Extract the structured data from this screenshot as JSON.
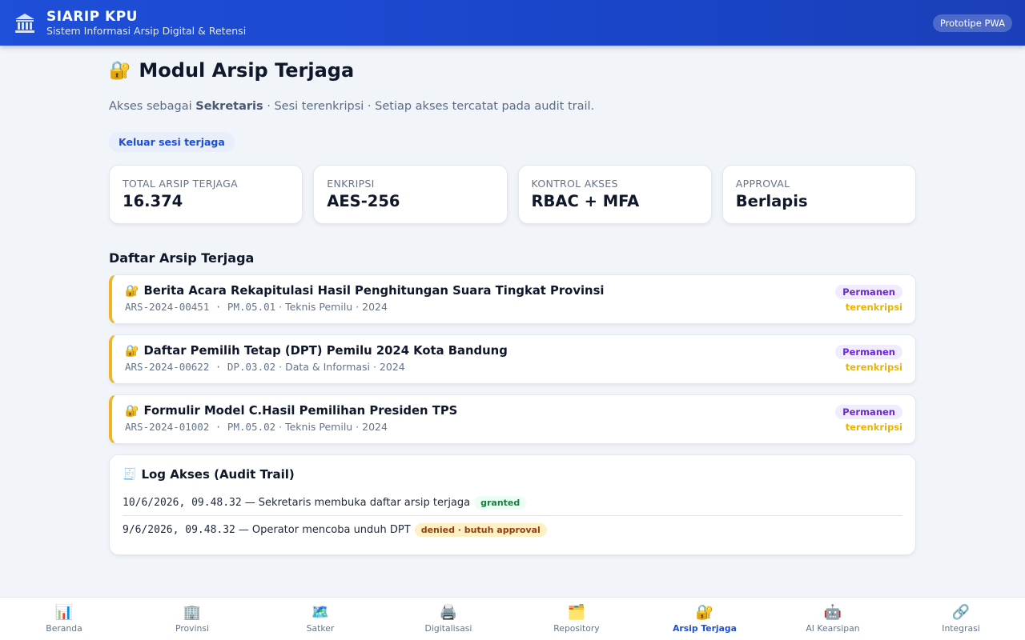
{
  "header": {
    "title": "SIARIP KPU",
    "subtitle": "Sistem Informasi Arsip Digital & Retensi",
    "badge": "Prototipe PWA"
  },
  "page": {
    "title": "Modul Arsip Terjaga",
    "subtitle_prefix": "Akses sebagai ",
    "role": "Sekretaris",
    "subtitle_suffix": " · Sesi terenkripsi · Setiap akses tercatat pada audit trail.",
    "logout_label": "Keluar sesi terjaga"
  },
  "stats": [
    {
      "label": "TOTAL ARSIP TERJAGA",
      "value": "16.374"
    },
    {
      "label": "ENKRIPSI",
      "value": "AES-256"
    },
    {
      "label": "KONTROL AKSES",
      "value": "RBAC + MFA"
    },
    {
      "label": "APPROVAL",
      "value": "Berlapis"
    }
  ],
  "list_title": "Daftar Arsip Terjaga",
  "archives": [
    {
      "title": "Berita Acara Rekapitulasi Hasil Penghitungan Suara Tingkat Provinsi",
      "code": "ARS-2024-00451 · PM.05.01",
      "meta": " · Teknis Pemilu · 2024",
      "retention": "Permanen",
      "status": "terenkripsi"
    },
    {
      "title": "Daftar Pemilih Tetap (DPT) Pemilu 2024 Kota Bandung",
      "code": "ARS-2024-00622 · DP.03.02",
      "meta": " · Data & Informasi · 2024",
      "retention": "Permanen",
      "status": "terenkripsi"
    },
    {
      "title": "Formulir Model C.Hasil Pemilihan Presiden TPS",
      "code": "ARS-2024-01002 · PM.05.02",
      "meta": " · Teknis Pemilu · 2024",
      "retention": "Permanen",
      "status": "terenkripsi"
    }
  ],
  "log": {
    "title": "Log Akses (Audit Trail)",
    "entries": [
      {
        "time": "10/6/2026, 09.48.32",
        "text": "Sekretaris membuka daftar arsip terjaga",
        "status": "granted"
      },
      {
        "time": "9/6/2026, 09.48.32",
        "text": "Operator mencoba unduh DPT",
        "status": "denied · butuh approval"
      }
    ]
  },
  "nav": [
    {
      "label": "Beranda",
      "icon": "chart-icon",
      "glyph": "📊"
    },
    {
      "label": "Provinsi",
      "icon": "building-icon",
      "glyph": "🏢"
    },
    {
      "label": "Satker",
      "icon": "map-icon",
      "glyph": "🗺️"
    },
    {
      "label": "Digitalisasi",
      "icon": "printer-icon",
      "glyph": "🖨️"
    },
    {
      "label": "Repository",
      "icon": "folder-icon",
      "glyph": "🗂️"
    },
    {
      "label": "Arsip Terjaga",
      "icon": "lock-icon",
      "glyph": "🔐"
    },
    {
      "label": "AI Kearsipan",
      "icon": "robot-icon",
      "glyph": "🤖"
    },
    {
      "label": "Integrasi",
      "icon": "link-icon",
      "glyph": "🔗"
    }
  ],
  "active_nav": "Arsip Terjaga",
  "colors": {
    "primary": "#1d4ed8",
    "accent_border": "#f0b429",
    "retention_badge": "#6d28d9",
    "encrypted": "#eab308"
  }
}
